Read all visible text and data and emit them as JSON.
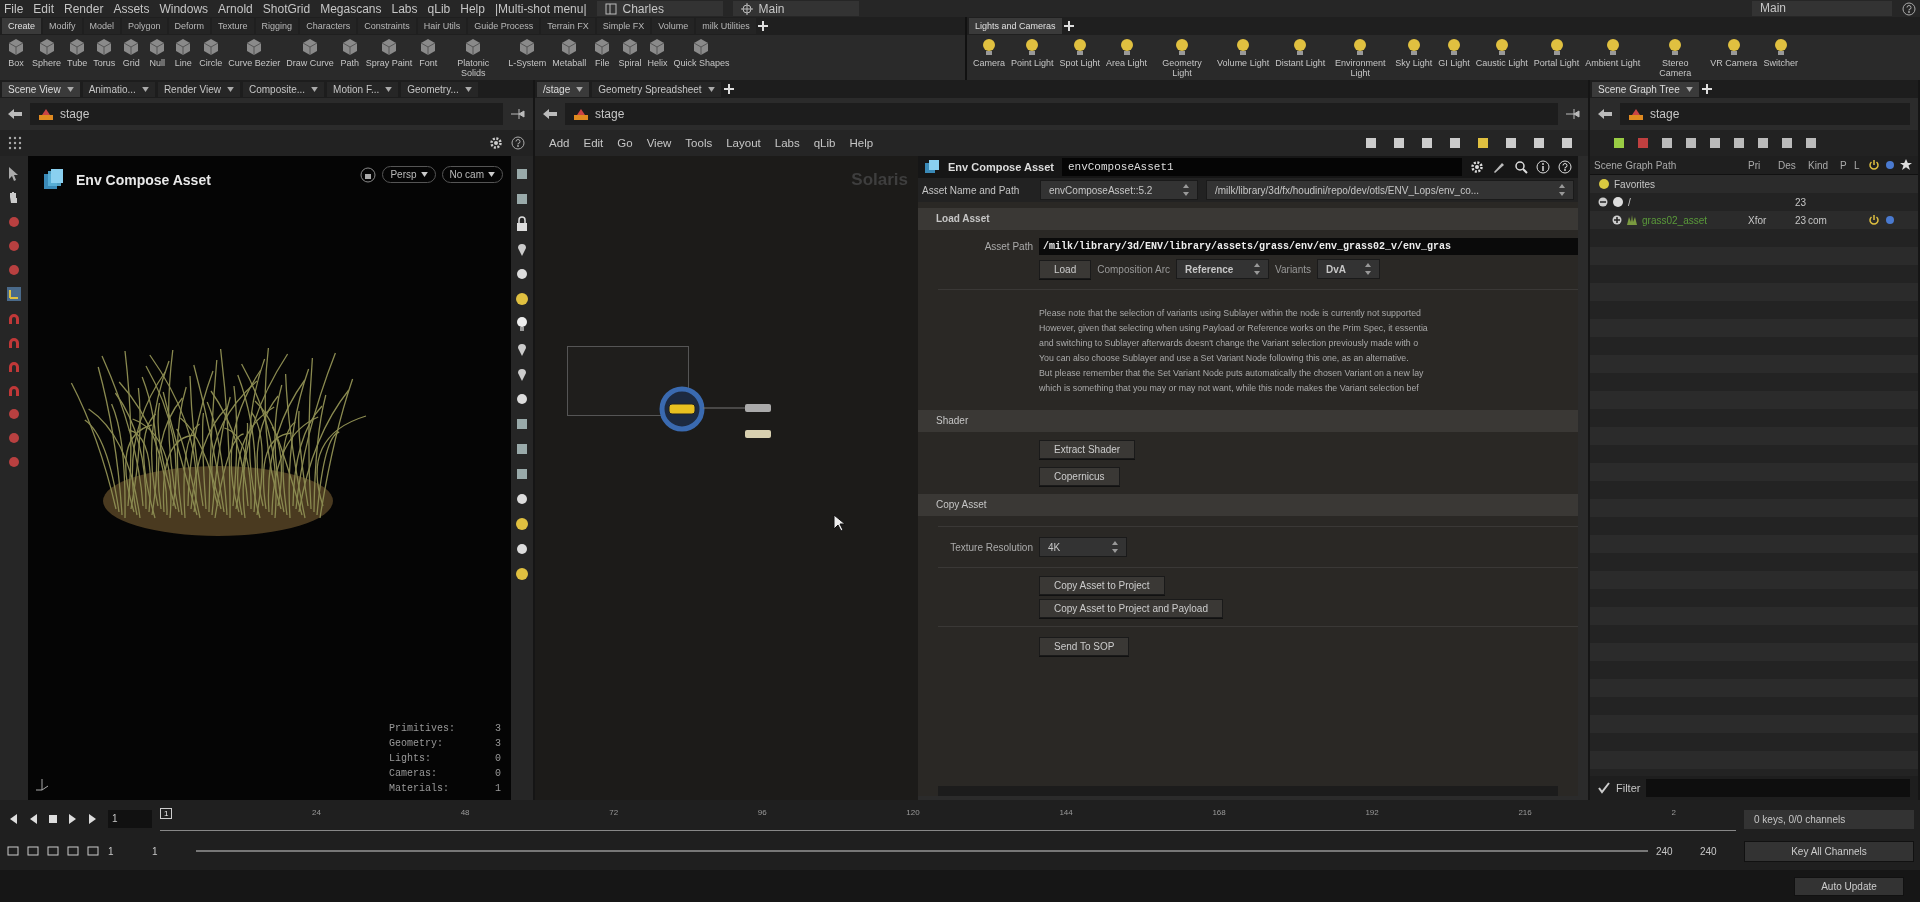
{
  "menu_bar": {
    "items": [
      "File",
      "Edit",
      "Render",
      "Assets",
      "Windows",
      "Arnold",
      "ShotGrid",
      "Megascans",
      "Labs",
      "qLib",
      "Help",
      "|Multi-shot menu|"
    ],
    "desktop": "Charles",
    "context": "Main",
    "right_desktop": "Main"
  },
  "shelf_left": {
    "tabs": [
      {
        "label": "Create",
        "selected": true
      },
      {
        "label": "Modify",
        "selected": false
      },
      {
        "label": "Model",
        "selected": false
      },
      {
        "label": "Polygon",
        "selected": false
      },
      {
        "label": "Deform",
        "selected": false
      },
      {
        "label": "Texture",
        "selected": false
      },
      {
        "label": "Rigging",
        "selected": false
      },
      {
        "label": "Characters",
        "selected": false
      },
      {
        "label": "Constraints",
        "selected": false
      },
      {
        "label": "Hair Utils",
        "selected": false
      },
      {
        "label": "Guide Process",
        "selected": false
      },
      {
        "label": "Terrain FX",
        "selected": false
      },
      {
        "label": "Simple FX",
        "selected": false
      },
      {
        "label": "Volume",
        "selected": false
      },
      {
        "label": "milk Utilities",
        "selected": false
      }
    ],
    "tools": [
      "Box",
      "Sphere",
      "Tube",
      "Torus",
      "Grid",
      "Null",
      "Line",
      "Circle",
      "Curve Bezier",
      "Draw Curve",
      "Path",
      "Spray Paint",
      "Font",
      "Platonic Solids",
      "L-System",
      "Metaball",
      "File",
      "Spiral",
      "Helix",
      "Quick Shapes"
    ]
  },
  "shelf_right": {
    "tabs": [
      {
        "label": "Lights and Cameras",
        "selected": true
      }
    ],
    "tools": [
      "Camera",
      "Point Light",
      "Spot Light",
      "Area Light",
      "Geometry Light",
      "Volume Light",
      "Distant Light",
      "Environment Light",
      "Sky Light",
      "GI Light",
      "Caustic Light",
      "Portal Light",
      "Ambient Light",
      "Stereo Camera",
      "VR Camera",
      "Switcher"
    ]
  },
  "left_pane": {
    "tabs": [
      {
        "label": "Scene View",
        "selected": true
      },
      {
        "label": "Animatio...",
        "selected": false
      },
      {
        "label": "Render View",
        "selected": false
      },
      {
        "label": "Composite...",
        "selected": false
      },
      {
        "label": "Motion F...",
        "selected": false
      },
      {
        "label": "Geometry...",
        "selected": false
      }
    ],
    "path": "stage",
    "viewport": {
      "title": "Env Compose Asset",
      "camera_menus": [
        "Persp",
        "No cam"
      ],
      "stats": [
        {
          "label": "Primitives:",
          "value": "3"
        },
        {
          "label": "Geometry:",
          "value": "3"
        },
        {
          "label": "Lights:",
          "value": "0"
        },
        {
          "label": "Cameras:",
          "value": "0"
        },
        {
          "label": "Materials:",
          "value": "1"
        }
      ]
    }
  },
  "network_pane": {
    "tabs": [
      {
        "label": "/stage",
        "selected": true
      },
      {
        "label": "Geometry Spreadsheet",
        "selected": false
      }
    ],
    "path": "stage",
    "menu": [
      "Add",
      "Edit",
      "Go",
      "View",
      "Tools",
      "Layout",
      "Labs",
      "qLib",
      "Help"
    ],
    "context_label": "Solaris"
  },
  "parameters": {
    "node_type": "Env Compose Asset",
    "node_name": "envComposeAsset1",
    "asset_name_label": "Asset Name and Path",
    "asset_name": "envComposeAsset::5.2",
    "asset_path": "/milk/library/3d/fx/houdini/repo/dev/otls/ENV_Lops/env_co...",
    "load_asset": {
      "title": "Load Asset",
      "asset_path_label": "Asset Path",
      "asset_path": "/milk/library/3d/ENV/library/assets/grass/env/env_grass02_v/env_gras",
      "load_button": "Load",
      "composition_arc_label": "Composition Arc",
      "composition_arc": "Reference",
      "variants_label": "Variants",
      "variants": "DvA",
      "note": "Please note that the selection of variants using Sublayer within the node is currently not supported\nHowever, given that selecting when using Payload or Reference works on the Prim Spec, it essentia\nand switching to Sublayer afterwards doesn't change the Variant selection previously made with o\nYou can also choose Sublayer and use a Set Variant Node following this one, as an alternative.\nBut please remember that the Set Variant Node puts automatically the chosen Variant on a new lay\nwhich is something that you may or may not want, while this node makes the Variant selection bef"
    },
    "shader": {
      "title": "Shader",
      "buttons": [
        "Extract Shader",
        "Copernicus"
      ]
    },
    "copy_asset": {
      "title": "Copy Asset",
      "texture_resolution_label": "Texture Resolution",
      "texture_resolution": "4K",
      "buttons": [
        "Copy Asset to Project",
        "Copy Asset to Project and Payload"
      ],
      "send_button": "Send To SOP"
    }
  },
  "scene_graph": {
    "tabs": [
      {
        "label": "Scene Graph Tree",
        "selected": true
      }
    ],
    "path": "stage",
    "columns": [
      "Scene Graph Path",
      "Pri",
      "Des",
      "Kind",
      "P",
      "L"
    ],
    "rows": [
      {
        "name": "Favorites",
        "kind": "favorites"
      },
      {
        "name": "/",
        "kind": "root",
        "expanded": true,
        "descendants": "23",
        "children": [
          {
            "name": "grass02_asset",
            "kind": "asset",
            "expanded": false,
            "primitive": "Xfor",
            "descendants": "23",
            "kind_column": "com",
            "active": true,
            "visible": true
          }
        ]
      }
    ],
    "filter_label": "Filter"
  },
  "timeline": {
    "frame": "1",
    "ticks": [
      "1",
      "24",
      "48",
      "72",
      "96",
      "120",
      "144",
      "168",
      "192",
      "216",
      "2"
    ],
    "range_start": [
      "1",
      "1"
    ],
    "range_end": [
      "240",
      "240"
    ],
    "keys_info": "0 keys, 0/0 channels",
    "key_all": "Key All Channels"
  },
  "status_bar": {
    "auto_update": "Auto Update"
  }
}
